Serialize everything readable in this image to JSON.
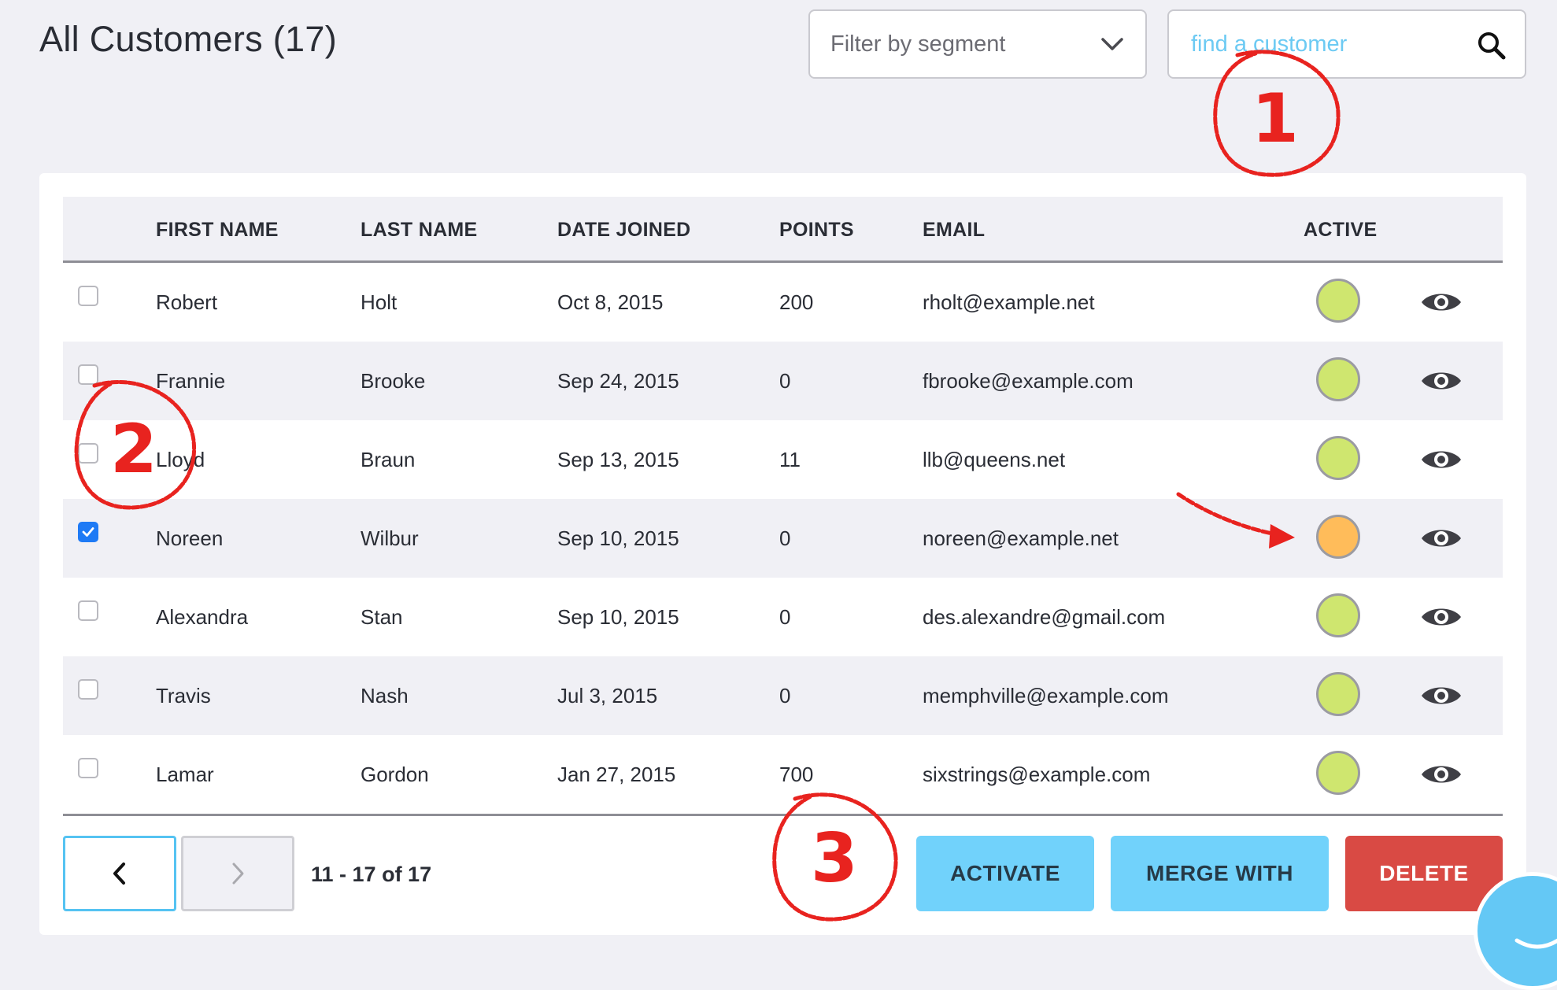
{
  "page": {
    "title": "All Customers (17)"
  },
  "filter": {
    "placeholder": "Filter by segment",
    "icon": "chevron-down-icon"
  },
  "search": {
    "placeholder": "find a customer",
    "icon": "search-icon"
  },
  "table": {
    "columns": [
      "FIRST NAME",
      "LAST NAME",
      "DATE JOINED",
      "POINTS",
      "EMAIL",
      "ACTIVE"
    ],
    "rows": [
      {
        "first": "Robert",
        "last": "Holt",
        "joined": "Oct 8, 2015",
        "points": "200",
        "email": "rholt@example.net",
        "checked": false,
        "status": "active"
      },
      {
        "first": "Frannie",
        "last": "Brooke",
        "joined": "Sep 24, 2015",
        "points": "0",
        "email": "fbrooke@example.com",
        "checked": false,
        "status": "active"
      },
      {
        "first": "Lloyd",
        "last": "Braun",
        "joined": "Sep 13, 2015",
        "points": "11",
        "email": "llb@queens.net",
        "checked": false,
        "status": "active"
      },
      {
        "first": "Noreen",
        "last": "Wilbur",
        "joined": "Sep 10, 2015",
        "points": "0",
        "email": "noreen@example.net",
        "checked": true,
        "status": "pending"
      },
      {
        "first": "Alexandra",
        "last": "Stan",
        "joined": "Sep 10, 2015",
        "points": "0",
        "email": "des.alexandre@gmail.com",
        "checked": false,
        "status": "active"
      },
      {
        "first": "Travis",
        "last": "Nash",
        "joined": "Jul 3, 2015",
        "points": "0",
        "email": "memphville@example.com",
        "checked": false,
        "status": "active"
      },
      {
        "first": "Lamar",
        "last": "Gordon",
        "joined": "Jan 27, 2015",
        "points": "700",
        "email": "sixstrings@example.com",
        "checked": false,
        "status": "active"
      }
    ]
  },
  "status_colors": {
    "active": "#cfe66f",
    "pending": "#ffbc5a"
  },
  "pagination": {
    "range": "11 - 17 of 17",
    "prev_icon": "chevron-left-icon",
    "next_icon": "chevron-right-icon"
  },
  "actions": {
    "activate": "ACTIVATE",
    "merge": "MERGE WITH",
    "delete": "DELETE"
  },
  "annotations": {
    "one": "1",
    "two": "2",
    "three": "3",
    "color": "#e8231f"
  },
  "chat": {
    "icon": "chat-bubble-icon"
  }
}
